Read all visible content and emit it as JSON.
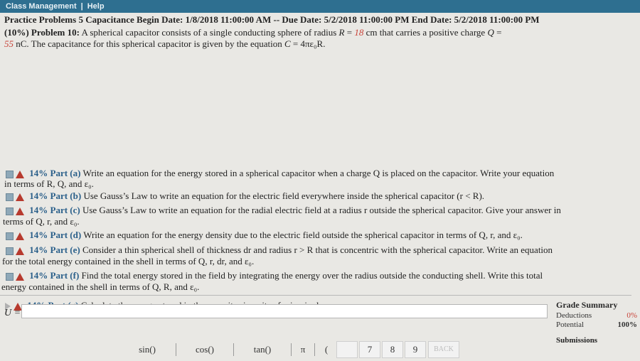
{
  "topbar": {
    "class_management": "Class Management",
    "sep": "|",
    "help": "Help"
  },
  "header": {
    "line": "Practice Problems 5 Capacitance Begin Date: 1/8/2018 11:00:00 AM -- Due Date: 5/2/2018 11:00:00 PM End Date: 5/2/2018 11:00:00 PM"
  },
  "problem": {
    "weight_title": "(10%) Problem 10:",
    "text_a": " A spherical capacitor consists of a single conducting sphere of radius ",
    "var_R": "R",
    "eq1": " = ",
    "radius_value": "18",
    "text_b": " cm that carries a positive charge ",
    "var_Q": "Q",
    "eq2": " =",
    "charge_value": "55",
    "text_c": " nC. The capacitance for this spherical capacitor is given by the equation ",
    "var_C": "C",
    "equation_rhs": " = 4πε₀R."
  },
  "parts": [
    {
      "label": "14% Part (a)",
      "text": "Write an equation for the energy stored in a spherical capacitor when a charge Q is placed on the capacitor. Write your equation",
      "text2": "in terms of R, Q, and ε₀."
    },
    {
      "label": "14% Part (b)",
      "text": "Use Gauss’s Law to write an equation for the electric field everywhere inside the spherical capacitor (r < R)."
    },
    {
      "label": "14% Part (c)",
      "text": "Use Gauss’s Law to write an equation for the radial electric field at a radius r outside the spherical capacitor. Give your answer in",
      "text2": "terms of Q, r, and ε₀."
    },
    {
      "label": "14% Part (d)",
      "text": "Write an equation for the energy density due to the electric field outside the spherical capacitor in terms of Q, r, and ε₀."
    },
    {
      "label": "14% Part (e)",
      "text": "Consider a thin spherical shell of thickness dr and radius r > R that is concentric with the spherical capacitor. Write an equation",
      "text2": "for the total energy contained in the shell in terms of Q, r, dr, and ε₀."
    },
    {
      "label": "14% Part (f)",
      "text": "Find the total energy stored in the field by integrating the energy over the radius outside the conducting shell. Write this total",
      "text2": "energy contained in the shell in terms of Q, R, and ε₀."
    },
    {
      "label": "14% Part (g)",
      "text": "Calculate the energy stored in the capacitor in units of microjoules."
    }
  ],
  "answer": {
    "label": "U =",
    "value": ""
  },
  "grade_summary": {
    "title": "Grade Summary",
    "deductions_label": "Deductions",
    "deductions_value": "0%",
    "potential_label": "Potential",
    "potential_value": "100%",
    "submissions_label": "Submissions"
  },
  "keypad": {
    "sin": "sin()",
    "cos": "cos()",
    "tan": "tan()",
    "pi": "π",
    "lparen": "(",
    "k7": "7",
    "k8": "8",
    "k9": "9",
    "backspace": "BACK"
  },
  "colors": {
    "topbar": "#2e6f90",
    "part_label": "#2a5f8a",
    "given_value": "#c8443a",
    "warning_icon": "#b73a2e"
  }
}
